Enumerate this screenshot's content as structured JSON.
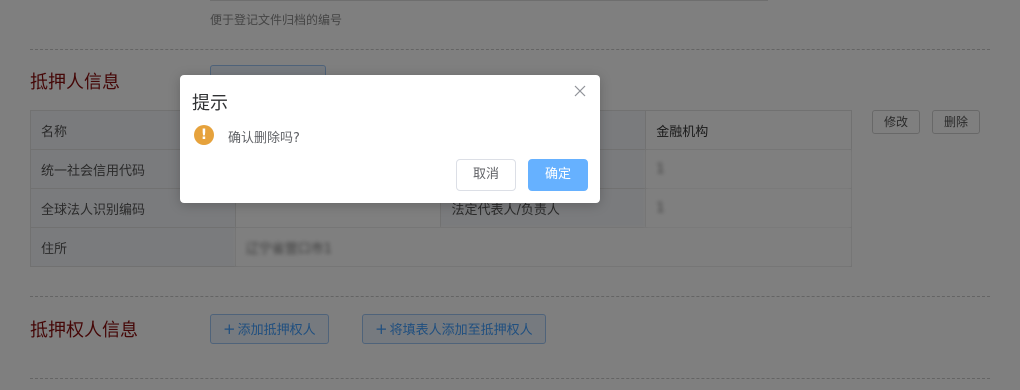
{
  "form": {
    "hint_text": "便于登记文件归档的编号"
  },
  "mortgagor": {
    "section_title": "抵押人信息",
    "table": {
      "rows": [
        [
          {
            "label": "名称"
          },
          {
            "value": ""
          },
          {
            "label": ""
          },
          {
            "value": "金融机构"
          }
        ],
        [
          {
            "label": "统一社会信用代码"
          },
          {
            "value": ""
          },
          {
            "label": ""
          },
          {
            "value": "1"
          }
        ],
        [
          {
            "label": "全球法人识别编码"
          },
          {
            "value": ""
          },
          {
            "label": "法定代表人/负责人"
          },
          {
            "value": "1"
          }
        ],
        [
          {
            "label": "住所"
          },
          {
            "value": "辽宁省营口市1"
          }
        ]
      ]
    },
    "edit_label": "修改",
    "delete_label": "删除"
  },
  "mortgagee": {
    "section_title": "抵押权人信息",
    "add_button": "添加抵押权人",
    "add_filler_button": "将填表人添加至抵押权人",
    "plus_glyph": "+"
  },
  "dialog": {
    "title": "提示",
    "message": "确认删除吗?",
    "icon_glyph": "!",
    "cancel_label": "取消",
    "confirm_label": "确定"
  },
  "colors": {
    "accent": "#409eff",
    "confirm_button": "#66b1ff",
    "warning": "#e6a23c",
    "section_title": "#8b0e0e"
  }
}
